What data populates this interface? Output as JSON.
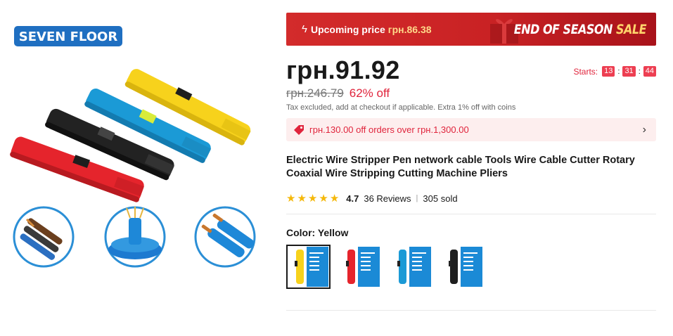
{
  "gallery": {
    "brand_logo": "SEVEN FLOOR",
    "image_icon": "wire-stripper-product-photo"
  },
  "promo": {
    "icon": "lightning-icon",
    "label": "Upcoming price",
    "price": "грн.86.38",
    "sale": "END OF SEASON",
    "sale_accent": "SALE"
  },
  "price": {
    "current": "грн.91.92",
    "original": "грн.246.79",
    "discount": "62% off",
    "tax_note": "Tax excluded, add at checkout if applicable. Extra 1% off with coins"
  },
  "timer": {
    "label": "Starts:",
    "hours": "13",
    "minutes": "31",
    "seconds": "44"
  },
  "coupon": {
    "icon": "tag-icon",
    "text": "грн.130.00 off orders over грн.1,300.00",
    "chevron": "›"
  },
  "product": {
    "title": "Electric Wire Stripper Pen network cable Tools Wire Cable Cutter Rotary Coaxial Wire Stripping Cutting Machine Pliers"
  },
  "rating": {
    "stars": 4.7,
    "value": "4.7",
    "reviews": "36 Reviews",
    "separator": "|",
    "sold": "305 sold"
  },
  "color": {
    "label": "Color:",
    "selected": "Yellow",
    "options": [
      {
        "name": "Yellow",
        "hex": "#f7d21c"
      },
      {
        "name": "Red",
        "hex": "#e5242c"
      },
      {
        "name": "Blue",
        "hex": "#1b9ad6"
      },
      {
        "name": "Black",
        "hex": "#1e1e1e"
      }
    ]
  },
  "colors": {
    "accent_red": "#e0243c",
    "banner_red": "#c92224",
    "star": "#f5b80a",
    "logo_blue": "#1f6fc1"
  }
}
